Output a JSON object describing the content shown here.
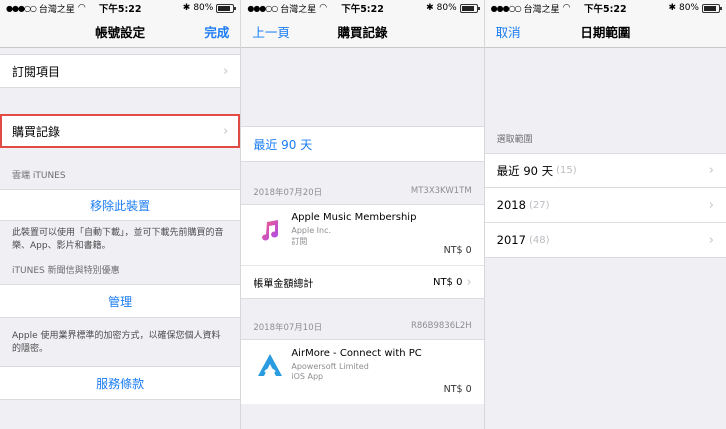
{
  "status": {
    "carrier": "台灣之星",
    "time": "下午5:22",
    "battery": "80%",
    "battery_level": 0.8
  },
  "screen1": {
    "title": "帳號設定",
    "done": "完成",
    "subscriptions": "訂閱項目",
    "purchase_history": "購買記錄",
    "cloud_header": "雲端 iTUNES",
    "remove_device": "移除此裝置",
    "remove_note": "此裝置可以使用「自動下載」，並可下載先前購買的音樂、App、影片和書籍。",
    "news_header": "iTUNES 新聞信與特別優惠",
    "manage": "管理",
    "encryption_note": "Apple 使用業界標準的加密方式，以確保您個人資料的隱密。",
    "terms": "服務條款"
  },
  "screen2": {
    "back": "上一頁",
    "title": "購買記錄",
    "range": "最近 90 天",
    "receipts": [
      {
        "date": "2018年07月20日",
        "order": "MT3X3KW1TM",
        "app_name": "Apple Music Membership",
        "developer": "Apple Inc.",
        "kind": "訂閱",
        "price": "NT$ 0"
      },
      {
        "date": "2018年07月10日",
        "order": "R86B9836L2H",
        "app_name": "AirMore - Connect with PC",
        "developer": "Apowersoft Limited",
        "kind": "iOS App",
        "price": "NT$ 0"
      }
    ],
    "total_label": "帳單金額總計",
    "total_value": "NT$ 0"
  },
  "screen3": {
    "cancel": "取消",
    "title": "日期範圍",
    "section": "選取範圍",
    "ranges": [
      {
        "label": "最近 90 天",
        "count": "(15)"
      },
      {
        "label": "2018",
        "count": "(27)"
      },
      {
        "label": "2017",
        "count": "(48)"
      }
    ]
  }
}
